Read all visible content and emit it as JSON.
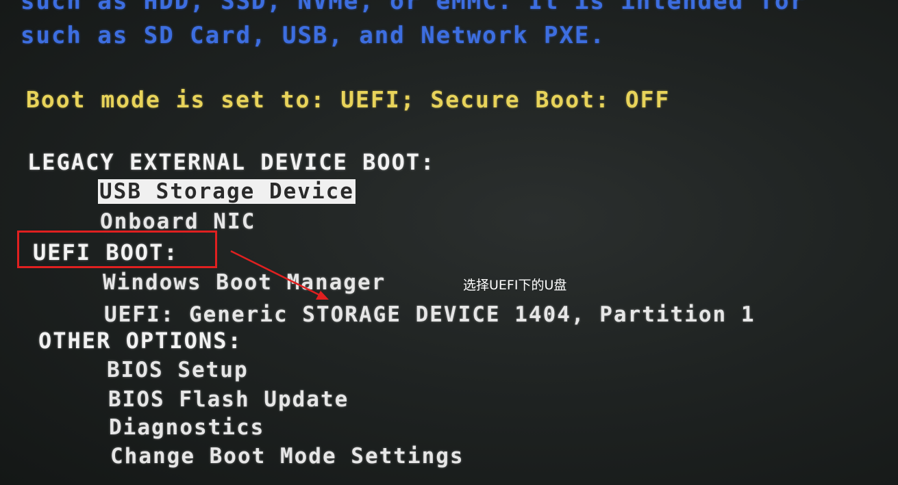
{
  "intro": {
    "line1": "such as HDD, SSD, NVMe, or eMMC. It is intended for",
    "line2": "such as SD Card, USB, and Network PXE."
  },
  "boot_mode_status": "Boot mode is set to: UEFI; Secure Boot: OFF",
  "sections": {
    "legacy": {
      "heading": "LEGACY EXTERNAL DEVICE BOOT:",
      "items": [
        "USB Storage Device",
        "Onboard NIC"
      ]
    },
    "uefi": {
      "heading": "UEFI BOOT:",
      "items": [
        "Windows Boot Manager",
        "UEFI: Generic STORAGE DEVICE 1404, Partition 1"
      ]
    },
    "other": {
      "heading": "OTHER OPTIONS:",
      "items": [
        "BIOS Setup",
        "BIOS Flash Update",
        "Diagnostics",
        "Change Boot Mode Settings"
      ]
    }
  },
  "annotation": {
    "note": "选择UEFI下的U盘",
    "color": "#e02020"
  },
  "colors": {
    "intro_text": "#3d6ee0",
    "status_text": "#e8d35a",
    "menu_text": "#e6e6e6",
    "selection_bg": "#f0f0f0"
  }
}
